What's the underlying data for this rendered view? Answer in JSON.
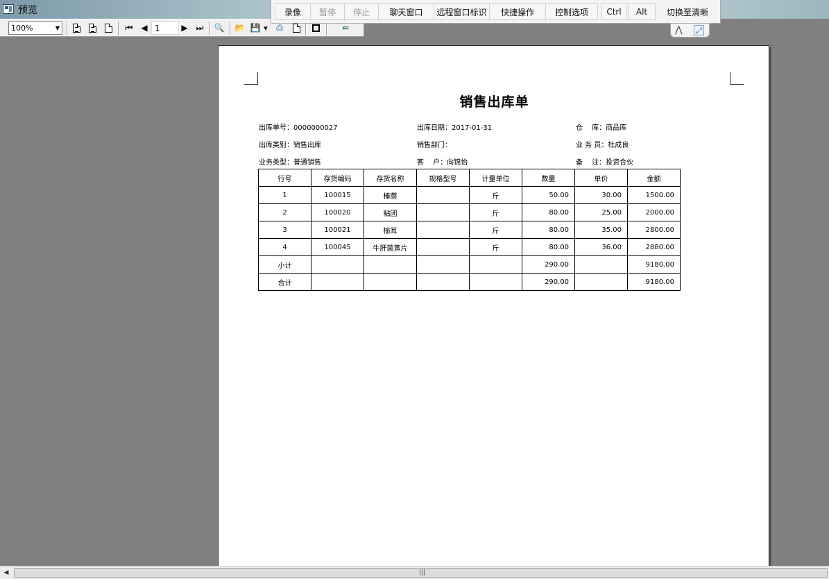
{
  "window": {
    "title": "预览"
  },
  "toolbar": {
    "zoom_value": "100%",
    "page_number": "1",
    "icons": [
      "page-layout-icon",
      "two-page-icon",
      "single-page-icon",
      "first-page-icon",
      "prev-page-icon",
      "next-page-icon",
      "last-page-icon",
      "magnifier-icon",
      "open-folder-icon",
      "save-disk-icon",
      "printer-icon",
      "blank-page-icon",
      "stop-icon",
      "exit-door-icon"
    ]
  },
  "remote_bar": {
    "buttons": [
      "录像",
      "暂停",
      "停止",
      "聊天窗口",
      "远程窗口标识",
      "快捷操作",
      "控制选项",
      "Ctrl",
      "Alt"
    ],
    "disabled": [
      "暂停",
      "停止"
    ],
    "switch_label": "切换至清晰"
  },
  "document": {
    "title": "销售出库单",
    "fields": {
      "out_no": "出库单号：0000000027",
      "out_date": "出库日期：2017-01-31",
      "warehouse": "仓　 库：商品库",
      "out_type": "出库类别：销售出库",
      "sales_dept": "销售部门：",
      "salesperson": "业 务 员：杜成良",
      "biz_type": "业务类型：普通销售",
      "customer": "客　 户：向锦怡",
      "remark": "备　 注：投资合伙"
    },
    "table": {
      "headers": [
        "行号",
        "存货编码",
        "存货名称",
        "规格型号",
        "计量单位",
        "数量",
        "单价",
        "金额"
      ],
      "rows": [
        [
          "1",
          "100015",
          "榛蘑",
          "",
          "斤",
          "50.00",
          "30.00",
          "1500.00"
        ],
        [
          "2",
          "100020",
          "粘团",
          "",
          "斤",
          "80.00",
          "25.00",
          "2000.00"
        ],
        [
          "3",
          "100021",
          "榆耳",
          "",
          "斤",
          "80.00",
          "35.00",
          "2800.00"
        ],
        [
          "4",
          "100045",
          "牛肝菌黄片",
          "",
          "斤",
          "80.00",
          "36.00",
          "2880.00"
        ],
        [
          "小计",
          "",
          "",
          "",
          "",
          "290.00",
          "",
          "9180.00"
        ],
        [
          "合计",
          "",
          "",
          "",
          "",
          "290.00",
          "",
          "9180.00"
        ]
      ]
    }
  },
  "colors": {
    "workspace": "#808080",
    "paper": "#ffffff",
    "link_blue": "#1a6ad0"
  }
}
